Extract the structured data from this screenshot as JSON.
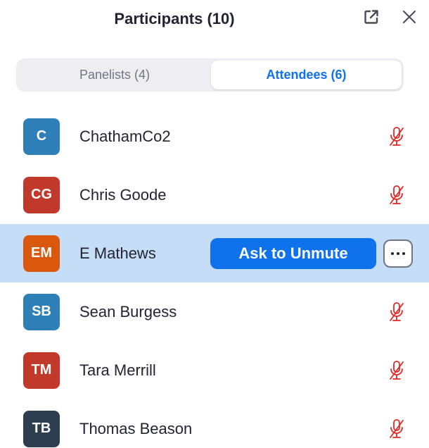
{
  "header": {
    "title": "Participants (10)",
    "popout_icon": "popout-icon",
    "close_icon": "close-icon"
  },
  "tabs": [
    {
      "label": "Panelists (4)",
      "active": false
    },
    {
      "label": "Attendees (6)",
      "active": true
    }
  ],
  "colors": {
    "accent": "#0e72ed",
    "muted_mic": "#e02828",
    "selected_row": "#c5ddf7"
  },
  "attendees": [
    {
      "initials": "C",
      "name": "ChathamCo2",
      "avatar_color": "#2e7fb8",
      "mic": "muted"
    },
    {
      "initials": "CG",
      "name": "Chris Goode",
      "avatar_color": "#c0392b",
      "mic": "muted"
    },
    {
      "initials": "EM",
      "name": "E Mathews",
      "avatar_color": "#d9580d",
      "mic": "hover-actions"
    },
    {
      "initials": "SB",
      "name": "Sean Burgess",
      "avatar_color": "#2e7fb8",
      "mic": "muted"
    },
    {
      "initials": "TM",
      "name": "Tara Merrill",
      "avatar_color": "#c0392b",
      "mic": "muted"
    },
    {
      "initials": "TB",
      "name": "Thomas Beason",
      "avatar_color": "#2c3e50",
      "mic": "muted"
    }
  ],
  "row_actions": {
    "ask_to_unmute_label": "Ask to Unmute",
    "more_icon": "more-options-icon"
  }
}
